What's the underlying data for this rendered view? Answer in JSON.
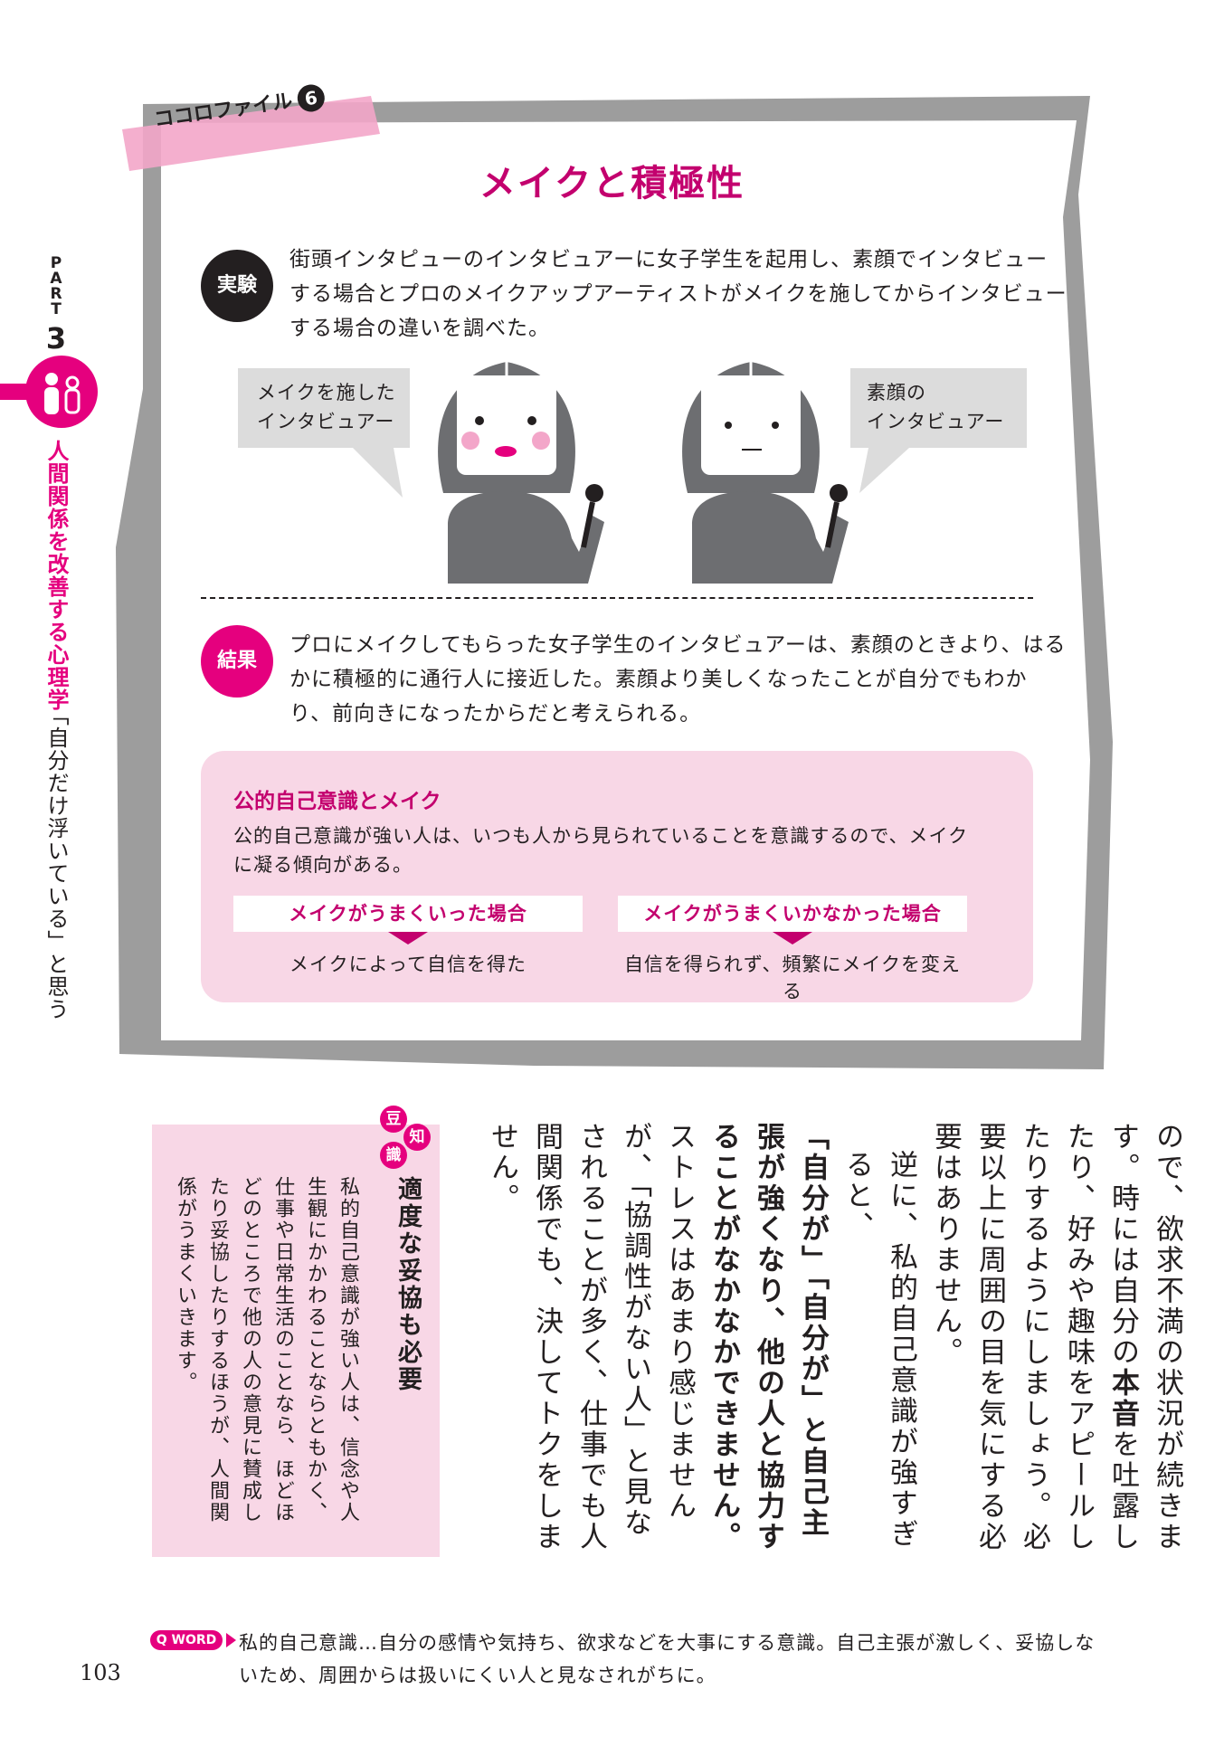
{
  "side": {
    "part_label": [
      "P",
      "A",
      "R",
      "T"
    ],
    "part_number": "3",
    "section_title": "人間関係を改善する心理学",
    "chapter_title": "「自分だけ浮いている」と思う"
  },
  "card": {
    "file_label": "ココロファイル",
    "file_number": "6",
    "title": "メイクと積極性",
    "experiment_badge": "実験",
    "experiment_text": "街頭インタピューのインタビュアーに女子学生を起用し、素顔でインタビューする場合とプロのメイクアップアーティストがメイクを施してからインタビューする場合の違いを調べた。",
    "bubble_left": [
      "メイクを施した",
      "インタビュアー"
    ],
    "bubble_right": [
      "素顔の",
      "インタビュアー"
    ],
    "result_badge": "結果",
    "result_text": "プロにメイクしてもらった女子学生のインタビュアーは、素顔のときより、はるかに積極的に通行人に接近した。素顔より美しくなったことが自分でもわかり、前向きになったからだと考えられる。",
    "info_title": "公的自己意識とメイク",
    "info_text": "公的自己意識が強い人は、いつも人から見られていることを意識するので、メイクに凝る傾向がある。",
    "case_success_label": "メイクがうまくいった場合",
    "case_success_result": "メイクによって自信を得た",
    "case_fail_label": "メイクがうまくいかなかった場合",
    "case_fail_result": "自信を得られず、頻繁にメイクを変える"
  },
  "body": {
    "p1_a": "ので、欲求不満の状況が続きます。時には自分の",
    "p1_bold": "本音",
    "p1_b": "を吐露したり、好みや趣味をアピールしたりするようにしましょう。必要以上に周囲の目を気にする必要はありません。",
    "p2_a": "逆に、私的自己意識が強すぎると、",
    "p2_bold": "「自分が」「自分が」と自己主張が強くなり、他の人と協力することがなかなかできません。",
    "p2_b": "ストレスはあまり感じませんが、「協調性がない人」と見なされることが多く、仕事でも人間関係でも、決してトクをしません。"
  },
  "mame": {
    "label": [
      "豆",
      "知",
      "識"
    ],
    "title": "適度な妥協も必要",
    "text": "私的自己意識が強い人は、信念や人生観にかかわることならともかく、仕事や日常生活のことなら、ほどほどのところで他の人の意見に賛成したり妥協したりするほうが、人間関係がうまくいきます。"
  },
  "footer": {
    "word_badge": "WORD",
    "word_text": "私的自己意識…自分の感情や気持ち、欲求などを大事にする意識。自己主張が激しく、妥協しないため、周囲からは扱いにくい人と見なされがちに。",
    "page_number": "103"
  },
  "colors": {
    "accent": "#e5007e",
    "title": "#c3006e",
    "pink_bg": "#f8d7e6",
    "gray": "#9d9d9d"
  }
}
